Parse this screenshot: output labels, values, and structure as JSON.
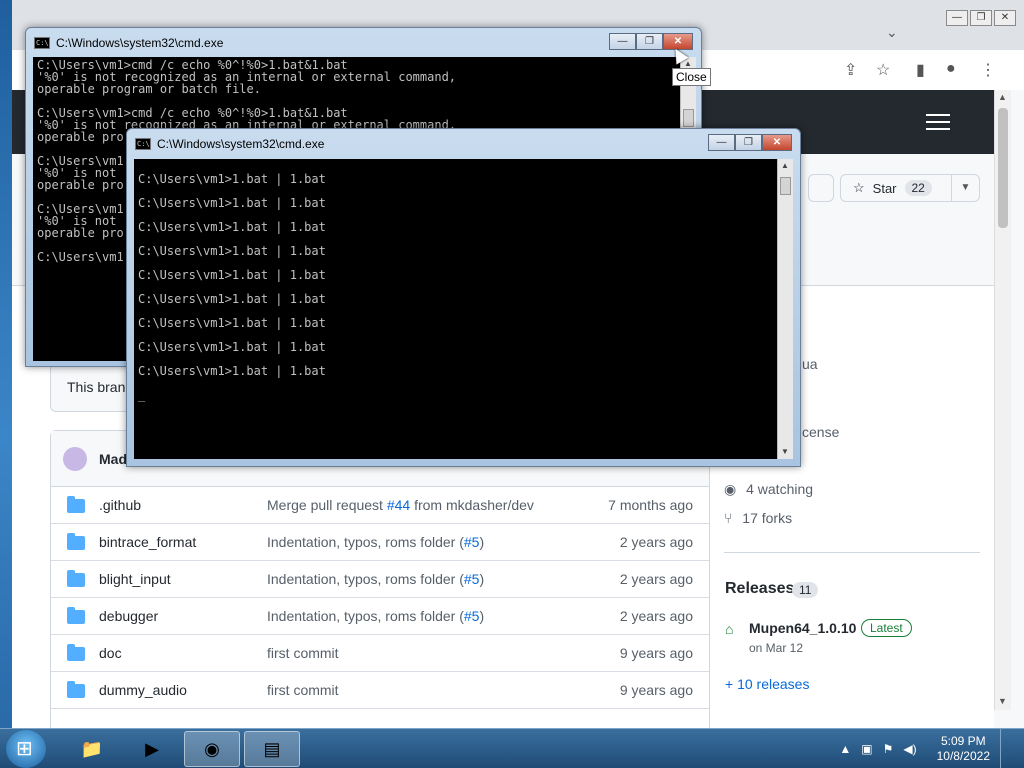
{
  "browser": {
    "tab_chevron": "⌄",
    "window_controls": [
      "—",
      "❐",
      "✕"
    ],
    "toolbar_icons": [
      "share-icon",
      "star-icon",
      "sidebar-icon",
      "profile-icon",
      "menu-icon"
    ]
  },
  "repo": {
    "star_label": "Star",
    "star_count": "22",
    "branch_text": "This branch",
    "owner_short": "Madg",
    "files": [
      {
        "name": ".github",
        "msg_pre": "Merge pull request ",
        "msg_link": "#44",
        "msg_post": " from mkdasher/dev",
        "time": "7 months ago"
      },
      {
        "name": "bintrace_format",
        "msg_pre": "Indentation, typos, roms folder (",
        "msg_link": "#5",
        "msg_post": ")",
        "time": "2 years ago"
      },
      {
        "name": "blight_input",
        "msg_pre": "Indentation, typos, roms folder (",
        "msg_link": "#5",
        "msg_post": ")",
        "time": "2 years ago"
      },
      {
        "name": "debugger",
        "msg_pre": "Indentation, typos, roms folder (",
        "msg_link": "#5",
        "msg_post": ")",
        "time": "2 years ago"
      },
      {
        "name": "doc",
        "msg_pre": "first commit",
        "msg_link": "",
        "msg_post": "",
        "time": "9 years ago"
      },
      {
        "name": "dummy_audio",
        "msg_pre": "first commit",
        "msg_link": "",
        "msg_post": "",
        "time": "9 years ago"
      }
    ],
    "sidebar": {
      "partial_lua": "ua",
      "partial_license": "cense",
      "watching": "4 watching",
      "forks": "17 forks",
      "releases_title": "Releases",
      "releases_count": "11",
      "release_name": "Mupen64_1.0.10",
      "release_badge": "Latest",
      "release_date": "on Mar 12",
      "more_releases": "+ 10 releases"
    }
  },
  "cmd_back": {
    "title": "C:\\Windows\\system32\\cmd.exe",
    "text": "C:\\Users\\vm1>cmd /c echo %0^!%0>1.bat&1.bat\n'%0' is not recognized as an internal or external command,\noperable program or batch file.\n\nC:\\Users\\vm1>cmd /c echo %0^!%0>1.bat&1.bat\n'%0' is not recognized as an internal or external command,\noperable pro\n\nC:\\Users\\vm1\n'%0' is not\noperable pro\n\nC:\\Users\\vm1\n'%0' is not\noperable pro\n\nC:\\Users\\vm1"
  },
  "cmd_front": {
    "title": "C:\\Windows\\system32\\cmd.exe",
    "text": "\nC:\\Users\\vm1>1.bat | 1.bat\n\nC:\\Users\\vm1>1.bat | 1.bat\n\nC:\\Users\\vm1>1.bat | 1.bat\n\nC:\\Users\\vm1>1.bat | 1.bat\n\nC:\\Users\\vm1>1.bat | 1.bat\n\nC:\\Users\\vm1>1.bat | 1.bat\n\nC:\\Users\\vm1>1.bat | 1.bat\n\nC:\\Users\\vm1>1.bat | 1.bat\n\nC:\\Users\\vm1>1.bat | 1.bat\n\n_"
  },
  "tooltip": "Close",
  "taskbar": {
    "time": "5:09 PM",
    "date": "10/8/2022"
  }
}
